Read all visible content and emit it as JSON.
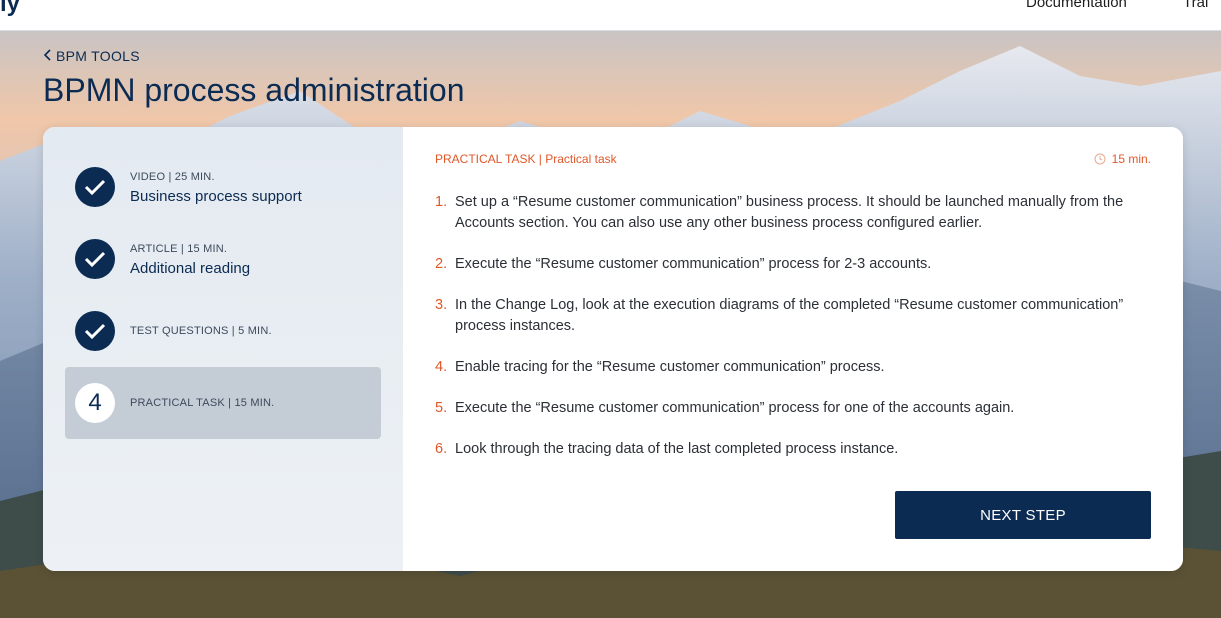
{
  "topbar": {
    "logo_fragment": "ly",
    "nav_documentation": "Documentation",
    "nav_training": "Trai"
  },
  "header": {
    "back_label": "BPM TOOLS",
    "title": "BPMN process administration"
  },
  "steps": [
    {
      "meta": "VIDEO | 25 MIN.",
      "name": "Business process support",
      "state": "done"
    },
    {
      "meta": "ARTICLE | 15 MIN.",
      "name": "Additional reading",
      "state": "done"
    },
    {
      "meta": "TEST QUESTIONS | 5 MIN.",
      "name": "",
      "state": "done"
    },
    {
      "meta": "PRACTICAL TASK | 15 MIN.",
      "name": "",
      "state": "active",
      "number": "4"
    }
  ],
  "content": {
    "label": "PRACTICAL TASK | Practical task",
    "duration": "15 min.",
    "tasks": [
      {
        "num": "1.",
        "text": "Set up a “Resume customer communication” business process. It should be launched manually from the Accounts section. You can also use any other business process configured earlier."
      },
      {
        "num": "2.",
        "text": "Execute the “Resume customer communication” process for 2-3 accounts."
      },
      {
        "num": "3.",
        "text": "In the Change Log, look at the execution diagrams of the completed “Resume customer communication” process instances."
      },
      {
        "num": "4.",
        "text": "Enable tracing for the “Resume customer communication” process."
      },
      {
        "num": "5.",
        "text": "Execute the “Resume customer communication” process for one of the accounts again."
      },
      {
        "num": "6.",
        "text": "Look through the tracing data of the last completed process instance."
      }
    ],
    "next_label": "NEXT STEP"
  },
  "colors": {
    "brand": "#0b2b52",
    "accent": "#e0582a"
  },
  "icons": {
    "back": "chevron-left-icon",
    "done": "checkmark-icon",
    "duration": "clock-icon"
  }
}
